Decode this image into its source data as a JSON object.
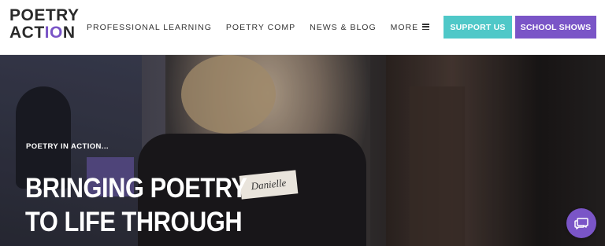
{
  "logo": {
    "line1": "POETRY",
    "line2_start": "ACT",
    "line2_accent": "IO",
    "line2_end": "N"
  },
  "nav": {
    "items": [
      "PROFESSIONAL LEARNING",
      "POETRY COMP",
      "NEWS & BLOG"
    ],
    "more_label": "MORE",
    "more_icon": "hamburger-menu-icon"
  },
  "buttons": {
    "support": "SUPPORT US",
    "shows": "SCHOOL SHOWS"
  },
  "hero": {
    "eyebrow": "POETRY IN ACTION...",
    "headline_lines": [
      "BRINGING POETRY",
      "TO LIFE THROUGH"
    ],
    "name_tag": "Danielle"
  },
  "chat": {
    "icon": "chat-bubbles-icon"
  },
  "colors": {
    "brand_purple": "#7a55c7",
    "brand_teal": "#4fc8c8",
    "nav_text": "#333333"
  }
}
